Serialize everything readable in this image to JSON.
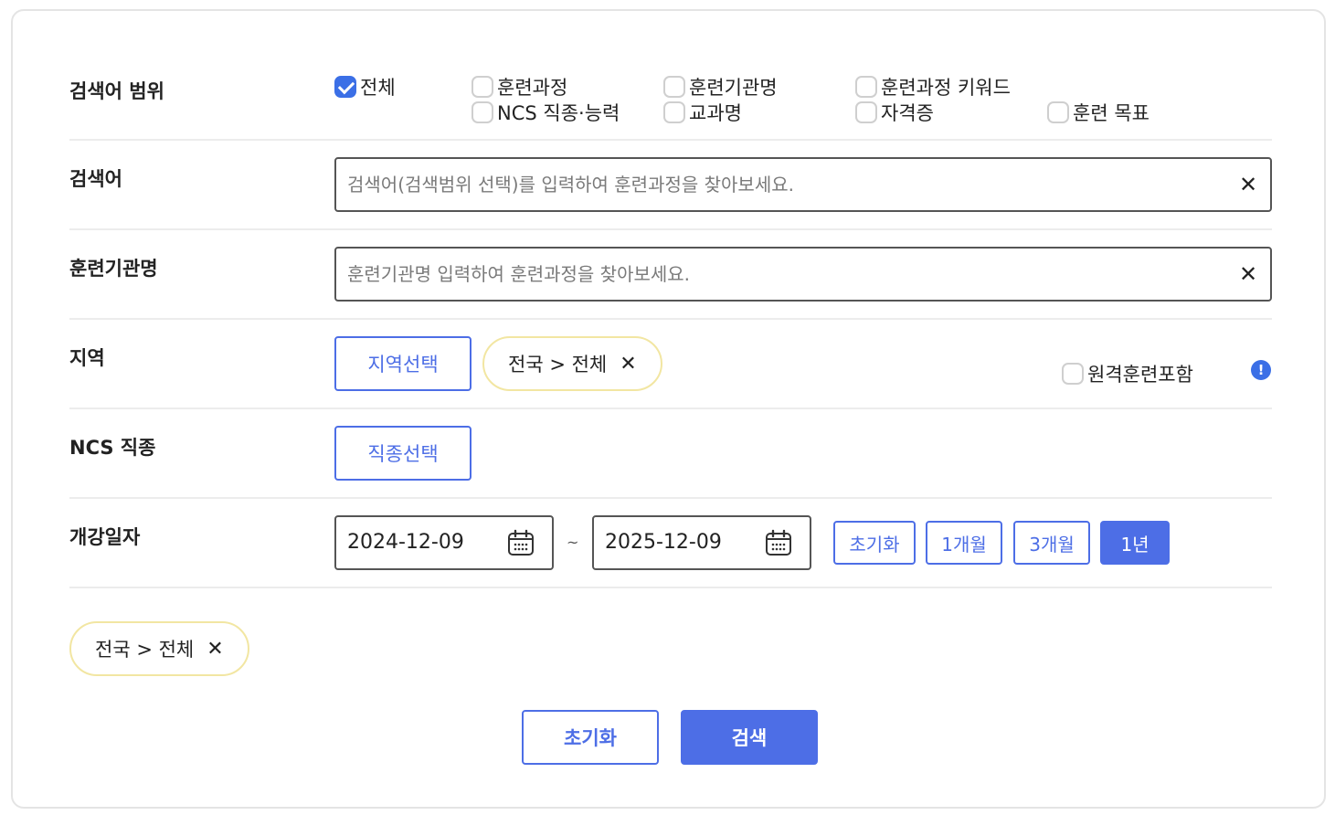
{
  "scope": {
    "label": "검색어 범위",
    "options": [
      {
        "label": "전체",
        "checked": true
      },
      {
        "label": "훈련과정",
        "checked": false
      },
      {
        "label": "훈련기관명",
        "checked": false
      },
      {
        "label": "훈련과정 키워드",
        "checked": false
      },
      {
        "label": "NCS 직종·능력",
        "checked": false
      },
      {
        "label": "교과명",
        "checked": false
      },
      {
        "label": "자격증",
        "checked": false
      },
      {
        "label": "훈련 목표",
        "checked": false
      }
    ]
  },
  "keyword": {
    "label": "검색어",
    "placeholder": "검색어(검색범위 선택)를 입력하여 훈련과정을 찾아보세요.",
    "value": "",
    "clear": "✕"
  },
  "institution": {
    "label": "훈련기관명",
    "placeholder": "훈련기관명 입력하여 훈련과정을 찾아보세요.",
    "value": "",
    "clear": "✕"
  },
  "region": {
    "label": "지역",
    "select_button": "지역선택",
    "chip": "전국 > 전체",
    "chip_remove": "✕",
    "remote_label": "원격훈련포함",
    "remote_checked": false,
    "info_icon": "!"
  },
  "ncs": {
    "label": "NCS 직종",
    "select_button": "직종선택"
  },
  "period": {
    "label": "개강일자",
    "start": "2024-12-09",
    "separator": "~",
    "end": "2025-12-09",
    "buttons": [
      {
        "label": "초기화",
        "active": false
      },
      {
        "label": "1개월",
        "active": false
      },
      {
        "label": "3개월",
        "active": false
      },
      {
        "label": "1년",
        "active": true
      }
    ]
  },
  "selected": {
    "chip": "전국 > 전체",
    "chip_remove": "✕"
  },
  "actions": {
    "reset": "초기화",
    "search": "검색"
  },
  "colors": {
    "accent": "#4d6ee6",
    "chip_border": "#f2e6a2",
    "divider": "#ececec"
  }
}
